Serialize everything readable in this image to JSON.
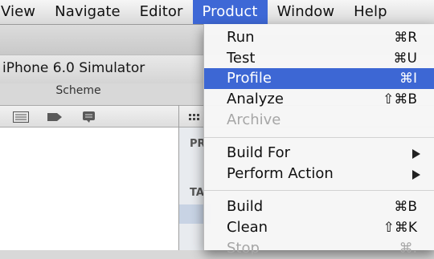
{
  "menubar": {
    "items": [
      "View",
      "Navigate",
      "Editor",
      "Product",
      "Window",
      "Help"
    ],
    "active": "Product"
  },
  "window": {
    "scheme_popup": "iPhone 6.0 Simulator",
    "scheme_label": "Scheme",
    "editor_section_1": "PR",
    "editor_section_2": "TA"
  },
  "product_menu": {
    "run": {
      "label": "Run",
      "shortcut": "⌘R"
    },
    "test": {
      "label": "Test",
      "shortcut": "⌘U"
    },
    "profile": {
      "label": "Profile",
      "shortcut": "⌘I"
    },
    "analyze": {
      "label": "Analyze",
      "shortcut": "⇧⌘B"
    },
    "archive": {
      "label": "Archive"
    },
    "build_for": {
      "label": "Build For"
    },
    "perform_action": {
      "label": "Perform Action"
    },
    "build": {
      "label": "Build",
      "shortcut": "⌘B"
    },
    "clean": {
      "label": "Clean",
      "shortcut": "⇧⌘K"
    },
    "stop": {
      "label": "Stop",
      "shortcut": "⌘."
    }
  },
  "colors": {
    "highlight": "#3d67d4",
    "menubar_active": "#3e68d6",
    "disabled_text": "#a6a6a6"
  },
  "icons": [
    "list-view-icon",
    "tag-icon",
    "speech-bubble-icon",
    "grid-icon"
  ]
}
